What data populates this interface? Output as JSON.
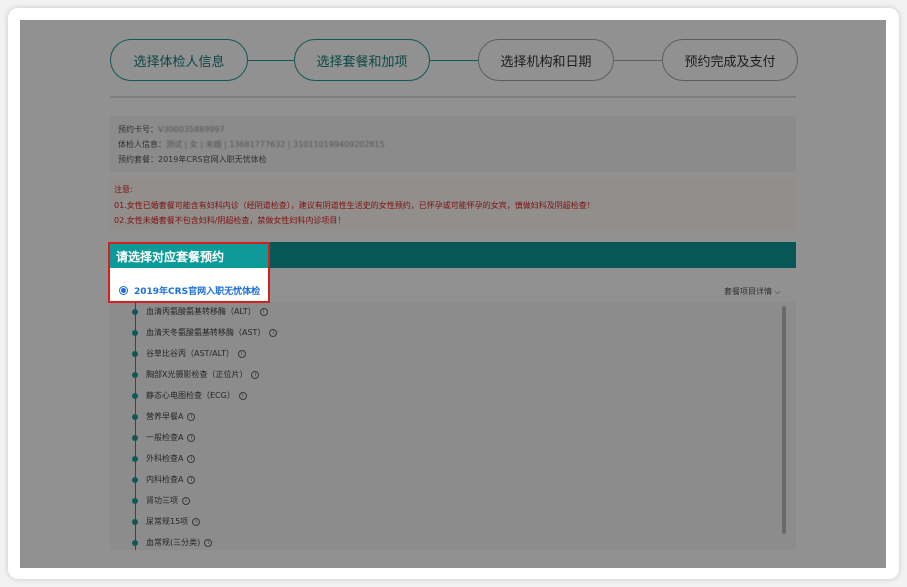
{
  "steps": [
    {
      "label": "选择体检人信息"
    },
    {
      "label": "选择套餐和加项"
    },
    {
      "label": "选择机构和日期"
    },
    {
      "label": "预约完成及支付"
    }
  ],
  "info": {
    "card_label": "预约卡号：",
    "card_value": "V300035889997",
    "person_label": "体检人信息：",
    "person_value": "测试 | 女 | 未婚 | 13681777632 | 310110199409202815",
    "package_label": "预约套餐：",
    "package_value": "2019年CRS官网入职无忧体检"
  },
  "notice": {
    "title": "注意:",
    "line1": "01.女性已婚套餐可能含有妇科内诊（经阴道检查），建议有阴道性生活史的女性预约，已怀孕或可能怀孕的女宾，慎做妇科及阴超检查！",
    "line2": "02.女性未婚套餐不包含妇科/阴超检查，禁做女性妇科内诊项目！"
  },
  "package_section": {
    "title": "请选择对应套餐预约",
    "selected_option": "2019年CRS官网入职无忧体检",
    "detail_link": "套餐项目详情"
  },
  "items": [
    {
      "label": "血清丙氨酸氨基转移酶（ALT）"
    },
    {
      "label": "血清天冬氨酸氨基转移酶（AST）"
    },
    {
      "label": "谷草比谷丙（AST/ALT）"
    },
    {
      "label": "胸部X光摄影检查（正位片）"
    },
    {
      "label": "静态心电图检查（ECG）"
    },
    {
      "label": "营养早餐A"
    },
    {
      "label": "一般检查A"
    },
    {
      "label": "外科检查A"
    },
    {
      "label": "内科检查A"
    },
    {
      "label": "肾功三项"
    },
    {
      "label": "尿常规15项"
    },
    {
      "label": "血常规(三分类)"
    }
  ],
  "colors": {
    "teal": "#0f9a9a",
    "highlight_border": "#d41f1f",
    "notice_text": "#dd2222",
    "radio_blue": "#1b6fd6"
  }
}
